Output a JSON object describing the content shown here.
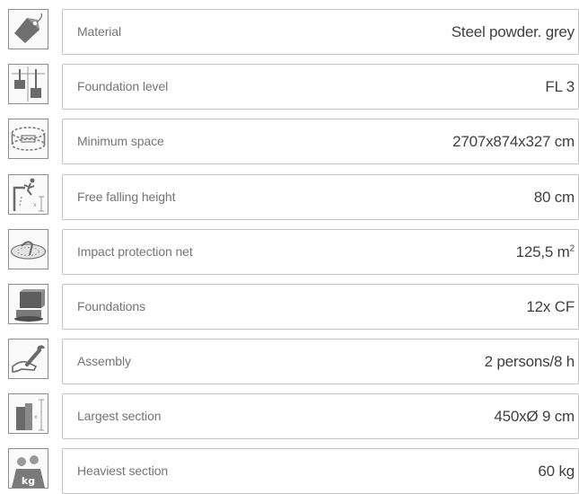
{
  "specs": [
    {
      "icon": "price-tag-icon",
      "label": "Material",
      "value": "Steel powder. grey"
    },
    {
      "icon": "foundation-level-icon",
      "label": "Foundation level",
      "value": "FL 3"
    },
    {
      "icon": "minimum-space-icon",
      "label": "Minimum space",
      "value": "2707x874x327 cm"
    },
    {
      "icon": "falling-height-icon",
      "label": "Free falling height",
      "value": "80 cm"
    },
    {
      "icon": "impact-net-icon",
      "label": "Impact protection net",
      "value": "125,5 m",
      "value_sup": "2"
    },
    {
      "icon": "foundation-block-icon",
      "label": "Foundations",
      "value": "12x CF"
    },
    {
      "icon": "wrench-hand-icon",
      "label": "Assembly",
      "value": "2 persons/8 h"
    },
    {
      "icon": "section-length-icon",
      "label": "Largest section",
      "value": "450xØ 9 cm"
    },
    {
      "icon": "weight-kg-icon",
      "label": "Heaviest section",
      "value": "60 kg",
      "icon_text": "kg"
    }
  ],
  "colors": {
    "icon_border": "#8e8e8e",
    "cell_border": "#c4c4c4",
    "label_text": "#757575",
    "value_text": "#3f3f3f",
    "icon_grey": "#6a6a6a"
  }
}
